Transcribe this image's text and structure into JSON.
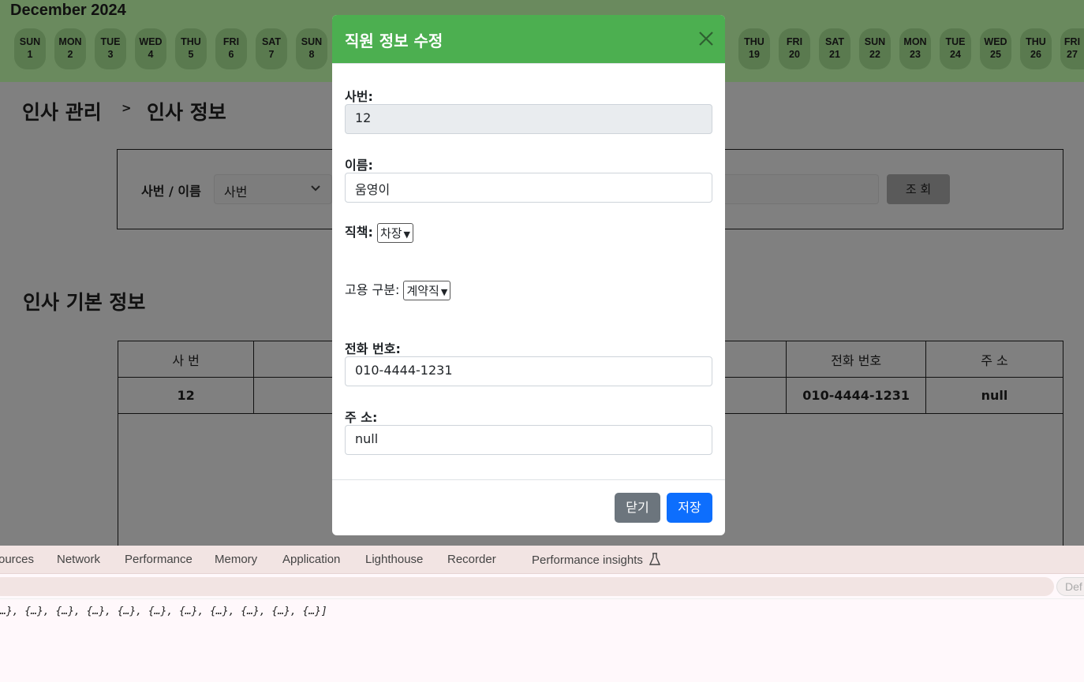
{
  "calendar": {
    "month": "December 2024",
    "days_left": [
      {
        "dow": "SUN",
        "day": "1"
      },
      {
        "dow": "MON",
        "day": "2"
      },
      {
        "dow": "TUE",
        "day": "3"
      },
      {
        "dow": "WED",
        "day": "4"
      },
      {
        "dow": "THU",
        "day": "5"
      },
      {
        "dow": "FRI",
        "day": "6"
      },
      {
        "dow": "SAT",
        "day": "7"
      },
      {
        "dow": "SUN",
        "day": "8"
      }
    ],
    "days_right": [
      {
        "dow": "THU",
        "day": "19"
      },
      {
        "dow": "FRI",
        "day": "20"
      },
      {
        "dow": "SAT",
        "day": "21"
      },
      {
        "dow": "SUN",
        "day": "22"
      },
      {
        "dow": "MON",
        "day": "23"
      },
      {
        "dow": "TUE",
        "day": "24"
      },
      {
        "dow": "WED",
        "day": "25"
      },
      {
        "dow": "THU",
        "day": "26"
      },
      {
        "dow": "FRI",
        "day": "27"
      }
    ]
  },
  "breadcrumb": {
    "root": "인사 관리",
    "separator": ">",
    "current": "인사 정보"
  },
  "search": {
    "label": "사번 / 이름",
    "select_value": "사번",
    "button_label": "조 회"
  },
  "section_title": "인사 기본 정보",
  "table": {
    "headers": [
      "사 번",
      "",
      "",
      "",
      "",
      "전화 번호",
      "주 소"
    ],
    "rows": [
      [
        "12",
        "",
        "",
        "",
        "",
        "010-4444-1231",
        "null"
      ]
    ]
  },
  "modal": {
    "title": "직원 정보 수정",
    "fields": {
      "emp_no_label": "사번:",
      "emp_no_value": "12",
      "name_label": "이름:",
      "name_value": "움영이",
      "position_label": "직책:",
      "position_value": "차장",
      "employment_label": "고용 구분:",
      "employment_value": "계약직",
      "phone_label": "전화 번호:",
      "phone_value": "010-4444-1231",
      "address_label": "주 소:",
      "address_value": "null"
    },
    "close_button": "닫기",
    "save_button": "저장"
  },
  "devtools": {
    "tabs": [
      "ources",
      "Network",
      "Performance",
      "Memory",
      "Application",
      "Lighthouse",
      "Recorder",
      "Performance insights"
    ],
    "levels_label": "Def",
    "console_line": "…}, {…}, {…}, {…}, {…}, {…}, {…}, {…}, {…}, {…}, {…}]"
  }
}
